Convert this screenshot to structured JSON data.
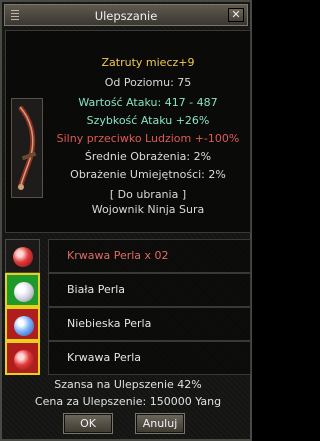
{
  "window": {
    "title": "Ulepszanie"
  },
  "item": {
    "name": "Zatruty miecz+9",
    "level_req": "Od Poziomu: 75",
    "stats": [
      {
        "text": "Wartość Ataku: 417 - 487",
        "color": "#86e3c6"
      },
      {
        "text": "Szybkość Ataku +26%",
        "color": "#86e3c6"
      },
      {
        "text": "Silny przeciwko Ludziom +-100%",
        "color": "#e05a56"
      },
      {
        "text": "Średnie Obrażenia: 2%",
        "color": "#dcdcdc"
      },
      {
        "text": "Obrażenie Umiejętności: 2%",
        "color": "#dcdcdc"
      }
    ],
    "wearable_header": "[ Do ubrania ]",
    "wearable_classes": "Wojownik Ninja Sura"
  },
  "materials": [
    {
      "label": "Krwawa Perla x 02",
      "label_color": "#e06a64",
      "icon": "red-pearl-icon",
      "pearl": "red",
      "slot_style": "plain"
    },
    {
      "label": "Biała Perla",
      "label_color": "#e6e6e6",
      "icon": "white-pearl-icon",
      "pearl": "white",
      "slot_style": "green"
    },
    {
      "label": "Niebieska Perla",
      "label_color": "#e6e6e6",
      "icon": "blue-pearl-icon",
      "pearl": "blue",
      "slot_style": "red"
    },
    {
      "label": "Krwawa Perla",
      "label_color": "#e6e6e6",
      "icon": "red-pearl-icon",
      "pearl": "red",
      "slot_style": "red"
    }
  ],
  "chance": "Szansa na Ulepszenie 42%",
  "cost": "Cena za Ulepszenie: 150000 Yang",
  "buttons": {
    "ok": "OK",
    "cancel": "Anuluj"
  },
  "colors": {
    "item_name": "#f2c94c",
    "level_req": "#dcdcdc",
    "wearable": "#dcdcdc"
  }
}
